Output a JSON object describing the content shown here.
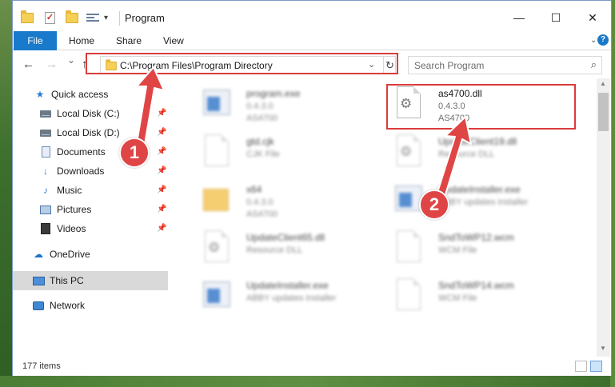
{
  "window": {
    "title": "Program",
    "controls": {
      "minimize": "—",
      "maximize": "☐",
      "close": "✕"
    }
  },
  "ribbon": {
    "tabs": [
      "File",
      "Home",
      "Share",
      "View"
    ],
    "help": "?"
  },
  "navbar": {
    "back": "←",
    "forward": "→",
    "recent": "⌄",
    "up": "↑",
    "address": "C:\\Program Files\\Program Directory",
    "search_placeholder": "Search Program"
  },
  "sidebar": {
    "items": [
      {
        "label": "Quick access",
        "icon": "quick-access-star-icon",
        "pinned": false
      },
      {
        "label": "Local Disk (C:)",
        "icon": "drive-icon",
        "pinned": true
      },
      {
        "label": "Local Disk (D:)",
        "icon": "drive-icon",
        "pinned": true
      },
      {
        "label": "Documents",
        "icon": "documents-icon",
        "pinned": true
      },
      {
        "label": "Downloads",
        "icon": "downloads-icon",
        "pinned": true
      },
      {
        "label": "Music",
        "icon": "music-icon",
        "pinned": true
      },
      {
        "label": "Pictures",
        "icon": "pictures-icon",
        "pinned": true
      },
      {
        "label": "Videos",
        "icon": "videos-icon",
        "pinned": true
      },
      {
        "label": "OneDrive",
        "icon": "onedrive-icon",
        "pinned": false
      },
      {
        "label": "This PC",
        "icon": "this-pc-icon",
        "pinned": false,
        "selected": true
      },
      {
        "label": "Network",
        "icon": "network-icon",
        "pinned": false
      }
    ]
  },
  "files": [
    {
      "name": "program.exe",
      "line2": "0.4.3.0",
      "line3": "AS4700",
      "icon": "exe-icon",
      "blurred": true
    },
    {
      "name": "as4700.dll",
      "line2": "0.4.3.0",
      "line3": "AS4700",
      "icon": "dll-gear-icon",
      "blurred": false
    },
    {
      "name": "gtd.cjk",
      "line2": "CJK File",
      "line3": "",
      "icon": "generic-file-icon",
      "blurred": true
    },
    {
      "name": "UpdateClient19.dll",
      "line2": "Resource DLL",
      "line3": "",
      "icon": "dll-gear-icon",
      "blurred": true
    },
    {
      "name": "x64",
      "line2": "0.4.3.0",
      "line3": "AS4700",
      "icon": "folder-icon",
      "blurred": true
    },
    {
      "name": "UpdateInstaller.exe",
      "line2": "ABBY updates installer",
      "line3": "",
      "icon": "exe-icon",
      "blurred": true
    },
    {
      "name": "UpdateClient65.dll",
      "line2": "Resource DLL",
      "line3": "",
      "icon": "dll-gear-icon",
      "blurred": true
    },
    {
      "name": "SndToWP12.wcm",
      "line2": "WCM File",
      "line3": "",
      "icon": "generic-file-icon",
      "blurred": true
    },
    {
      "name": "UpdateInstaller.exe",
      "line2": "ABBY updates installer",
      "line3": "",
      "icon": "exe-icon",
      "blurred": true
    },
    {
      "name": "SndToWP14.wcm",
      "line2": "WCM File",
      "line3": "",
      "icon": "generic-file-icon",
      "blurred": true
    }
  ],
  "status": {
    "count": "177 items"
  },
  "callouts": [
    {
      "number": "1",
      "color": "#e04545"
    },
    {
      "number": "2",
      "color": "#e04545"
    }
  ],
  "colors": {
    "accent": "#1979ca",
    "highlight": "#dc3b3b"
  }
}
